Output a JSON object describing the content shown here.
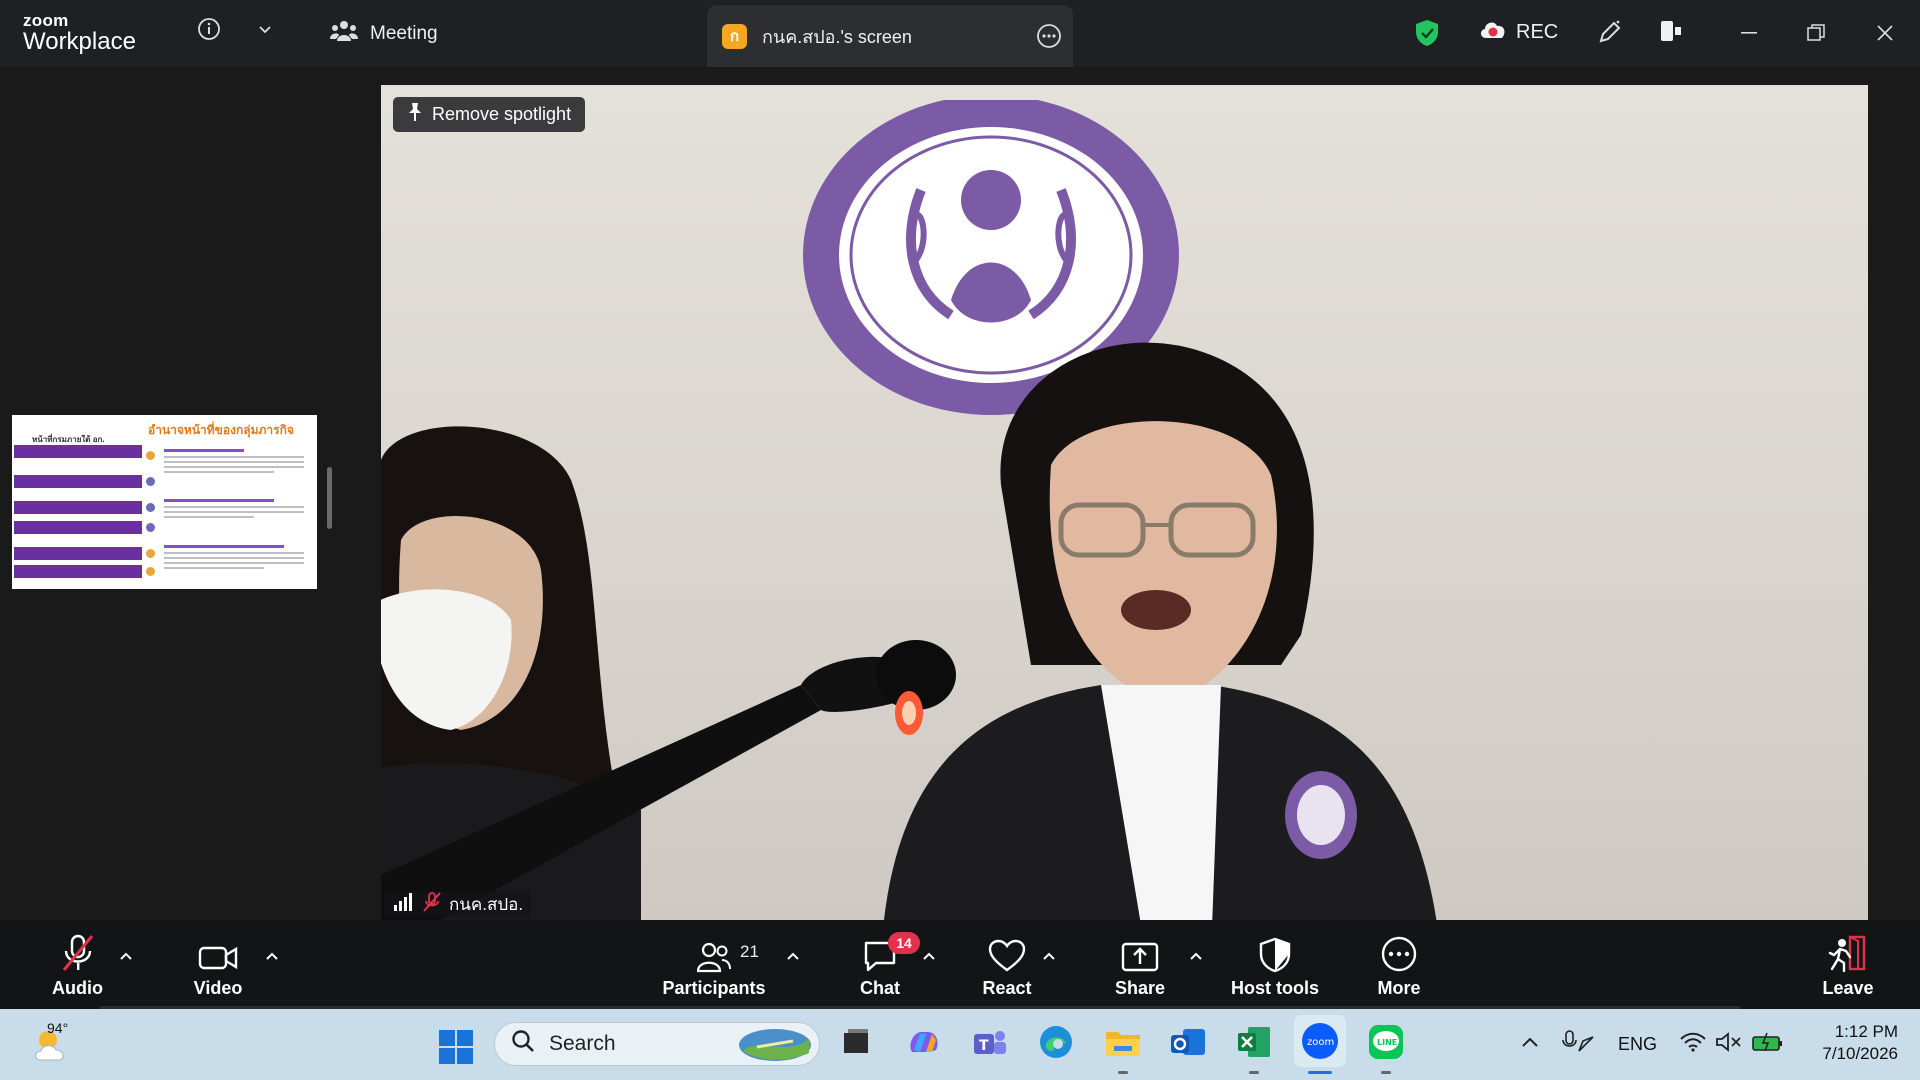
{
  "titlebar": {
    "logo_line1": "zoom",
    "logo_line2": "Workplace",
    "meeting_label": "Meeting",
    "screen_tab_badge": "ก",
    "screen_tab_label": "กนค.สปอ.'s screen",
    "rec_label": "REC"
  },
  "stage": {
    "remove_spotlight_label": "Remove spotlight",
    "participant_name": "กนค.สปอ.",
    "thumbnail": {
      "left_title": "หน้าที่กรมภายใต้ อก.",
      "right_title": "อำนาจหน้าที่ของกลุ่มภารกิจ"
    }
  },
  "controls": {
    "audio_label": "Audio",
    "video_label": "Video",
    "participants_label": "Participants",
    "participants_count": "21",
    "chat_label": "Chat",
    "chat_badge": "14",
    "react_label": "React",
    "share_label": "Share",
    "host_tools_label": "Host tools",
    "more_label": "More",
    "leave_label": "Leave"
  },
  "taskbar": {
    "weather_temp": "94°",
    "search_placeholder": "Search",
    "language": "ENG",
    "time": "1:12 PM",
    "date": "7/10/2026"
  },
  "colors": {
    "titlebar_bg": "#1f2023",
    "control_bar_bg": "#131416",
    "taskbar_bg": "#c8dde9",
    "chat_badge": "#e0334b",
    "seal_purple": "#7b5aa6",
    "leave_red": "#e0334b",
    "shield_green": "#22c55e"
  },
  "icons": {
    "info": "info-icon",
    "chevron": "chevron-down-icon",
    "meeting": "people-icon",
    "shield": "shield-check-icon",
    "cloud_rec": "cloud-record-icon",
    "annotate": "pen-icon",
    "minimize": "minimize-icon",
    "restore": "restore-icon",
    "close": "close-icon",
    "mic_muted": "mic-muted-icon",
    "camera": "camera-icon",
    "participants": "participants-icon",
    "chat": "chat-icon",
    "react": "heart-icon",
    "share": "share-screen-icon",
    "host_tools": "shield-icon",
    "more": "ellipsis-icon",
    "leave": "leave-icon"
  }
}
